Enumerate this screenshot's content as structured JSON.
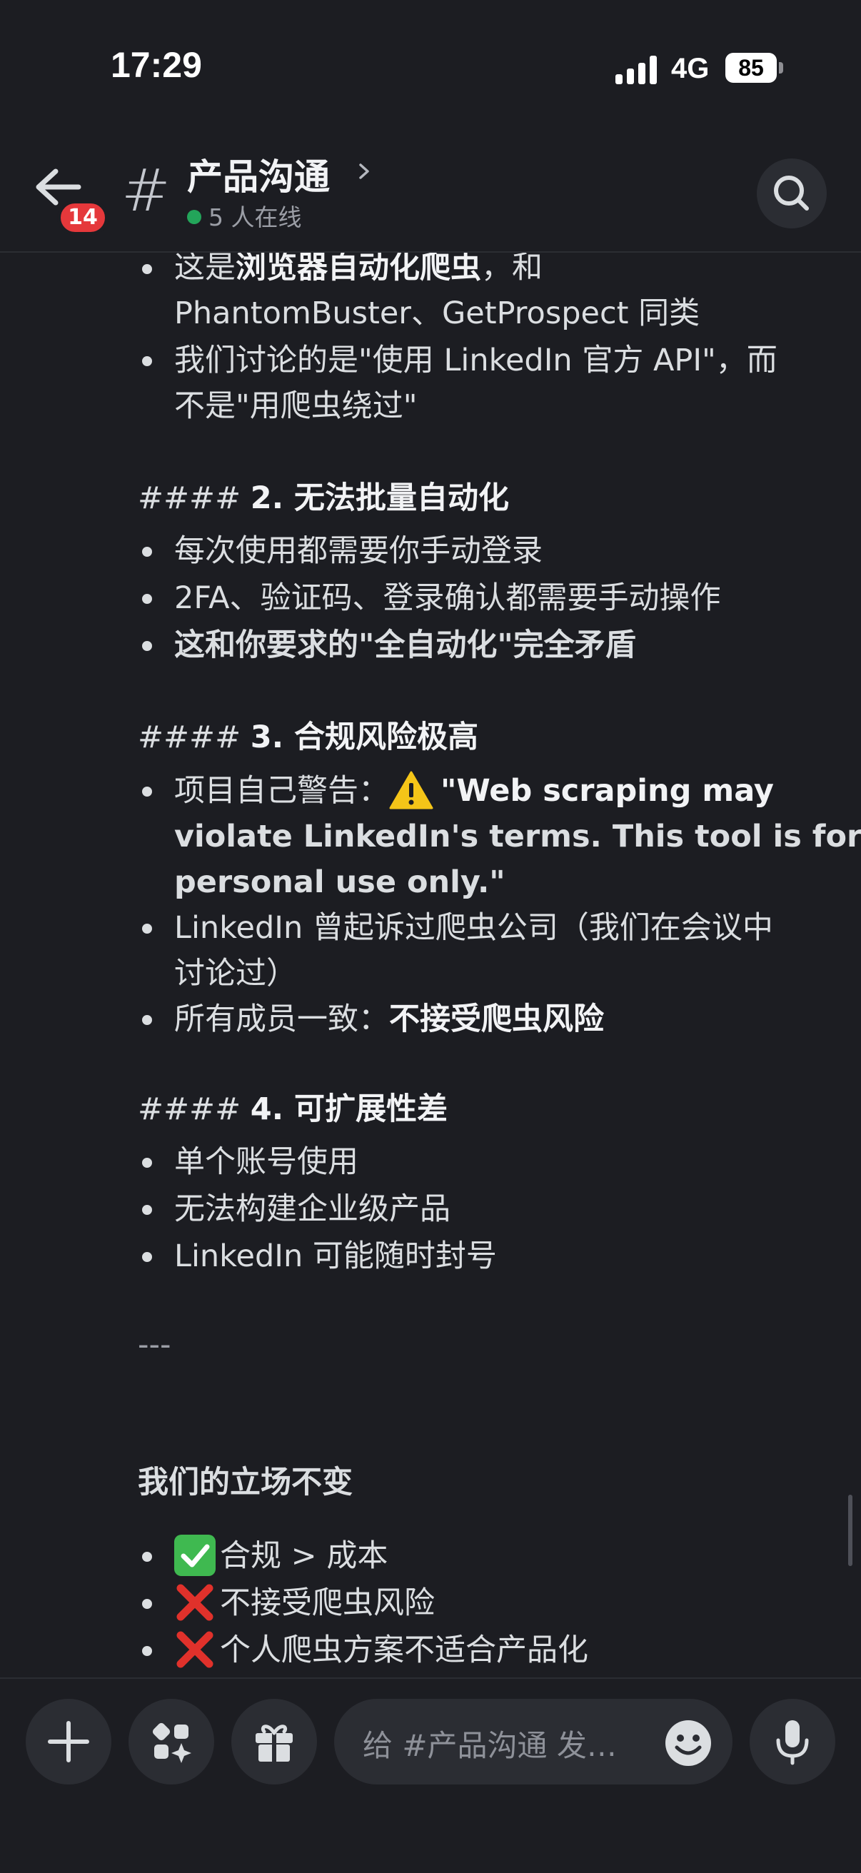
{
  "status_bar": {
    "time": "17:29",
    "network": "4G",
    "battery": "85"
  },
  "header": {
    "back_badge": "14",
    "channel_prefix": "#",
    "channel_name": "产品沟通",
    "online_status": "5 人在线"
  },
  "message": {
    "l1_a": "这是",
    "l1_b": "浏览器自动化爬虫",
    "l1_c": "，和",
    "l2": "PhantomBuster、GetProspect 同类",
    "l3": "我们讨论的是\"使用 LinkedIn 官方 API\"，而",
    "l4": "不是\"用爬虫绕过\"",
    "h2_prefix": "####",
    "h2": "2. 无法批量自动化",
    "b2_1": "每次使用都需要你手动登录",
    "b2_2": "2FA、验证码、登录确认都需要手动操作",
    "b2_3": "这和你要求的\"全自动化\"完全矛盾",
    "h3_prefix": "####",
    "h3": "3. 合规风险极高",
    "b3_1_a": "项目自己警告：",
    "b3_1_b": "\"Web scraping may",
    "b3_1_c": "violate LinkedIn's terms. This tool is for",
    "b3_1_d": "personal use only.\"",
    "b3_2_a": "LinkedIn 曾起诉过爬虫公司（我们在会议中",
    "b3_2_b": "讨论过）",
    "b3_3_a": "所有成员一致：",
    "b3_3_b": "不接受爬虫风险",
    "h4_prefix": "####",
    "h4": "4. 可扩展性差",
    "b4_1": "单个账号使用",
    "b4_2": "无法构建企业级产品",
    "b4_3": "LinkedIn 可能随时封号",
    "hr": "---",
    "stance_title": "我们的立场不变",
    "s1": "合规 > 成本",
    "s2": "不接受爬虫风险",
    "s3": "个人爬虫方案不适合产品化"
  },
  "composer": {
    "placeholder": "给 #产品沟通 发…"
  },
  "colors": {
    "background": "#1c1d22",
    "badge": "#e5383b",
    "online": "#23a55a",
    "warning": "#f5c518",
    "check": "#3fb950",
    "cross": "#e0312b"
  }
}
